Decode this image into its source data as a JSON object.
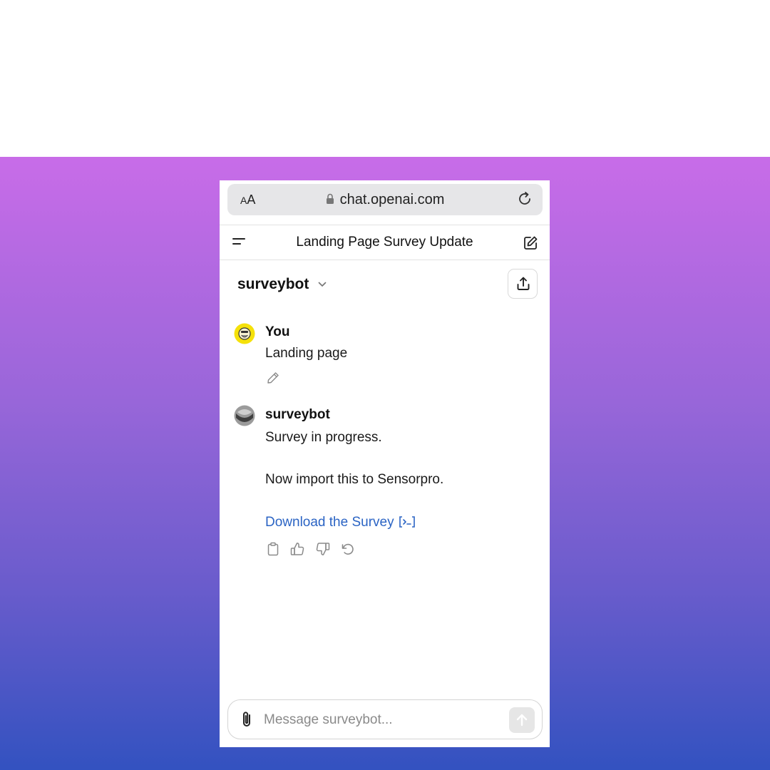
{
  "browser": {
    "text_size_button": {
      "small": "A",
      "large": "A"
    },
    "url": "chat.openai.com"
  },
  "header": {
    "title": "Landing Page Survey Update"
  },
  "model": {
    "name": "surveybot"
  },
  "conversation": {
    "user": {
      "author": "You",
      "message": "Landing page"
    },
    "bot": {
      "author": "surveybot",
      "message_1": "Survey in progress.",
      "message_2": "Now import this to Sensorpro.",
      "link_text": "Download the Survey"
    }
  },
  "composer": {
    "placeholder": "Message surveybot..."
  },
  "colors": {
    "link": "#2b64c4",
    "gradient_top": "#c86ce8",
    "gradient_bottom": "#3352c0",
    "user_avatar": "#f5e10a"
  },
  "icons": [
    "text-size-icon",
    "lock-icon",
    "reload-icon",
    "menu-icon",
    "compose-icon",
    "chevron-down-icon",
    "share-icon",
    "user-avatar-icon",
    "bot-avatar-icon",
    "pencil-icon",
    "code-interpreter-icon",
    "copy-icon",
    "thumbs-up-icon",
    "thumbs-down-icon",
    "regenerate-icon",
    "paperclip-icon",
    "arrow-up-icon"
  ]
}
